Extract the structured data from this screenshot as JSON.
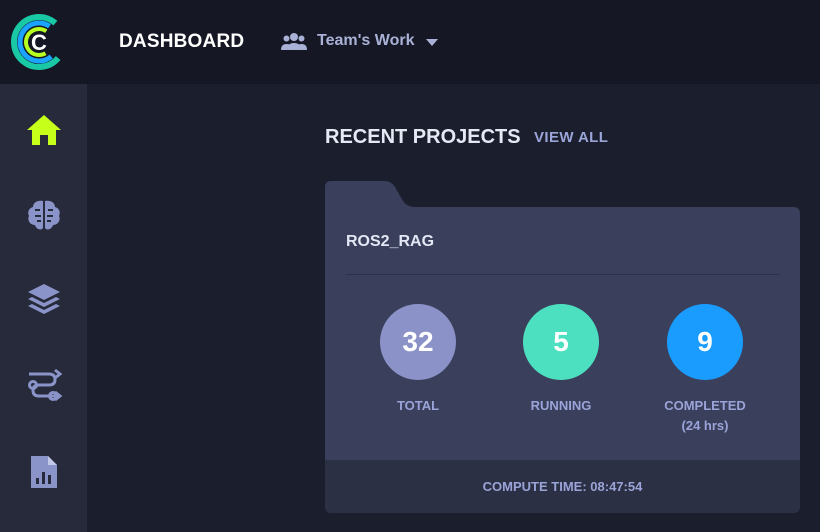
{
  "header": {
    "title": "DASHBOARD",
    "team_label": "Team's Work"
  },
  "sidebar": {
    "items": [
      {
        "name": "home",
        "icon": "home-icon",
        "active": true
      },
      {
        "name": "models",
        "icon": "brain-icon",
        "active": false
      },
      {
        "name": "layers",
        "icon": "layers-icon",
        "active": false
      },
      {
        "name": "pipelines",
        "icon": "pipeline-icon",
        "active": false
      },
      {
        "name": "reports",
        "icon": "report-icon",
        "active": false
      }
    ]
  },
  "recent": {
    "title": "RECENT PROJECTS",
    "view_all": "VIEW ALL"
  },
  "project": {
    "name": "ROS2_RAG",
    "stats": [
      {
        "value": "32",
        "label": "TOTAL",
        "color": "#8a92c8"
      },
      {
        "value": "5",
        "label": "RUNNING",
        "color": "#4de0c0"
      },
      {
        "value": "9",
        "label": "COMPLETED",
        "sublabel": "(24 hrs)",
        "color": "#1a9cff"
      }
    ],
    "compute_time": "COMPUTE TIME: 08:47:54"
  },
  "colors": {
    "accent_active": "#c6ff1a",
    "icon_inactive": "#8a94c9"
  }
}
